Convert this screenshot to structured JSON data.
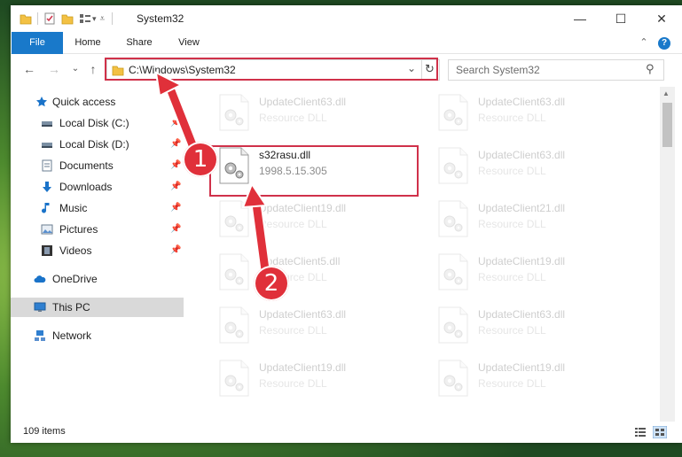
{
  "window": {
    "title": "System32",
    "minimize_glyph": "—",
    "maximize_glyph": "☐",
    "close_glyph": "✕",
    "help_glyph": "?",
    "collapse_glyph": "⌃"
  },
  "ribbon": {
    "tabs": [
      {
        "label": "File"
      },
      {
        "label": "Home"
      },
      {
        "label": "Share"
      },
      {
        "label": "View"
      }
    ]
  },
  "nav": {
    "back_glyph": "←",
    "forward_glyph": "→",
    "recent_glyph": "⌄",
    "up_glyph": "↑",
    "address": "C:\\Windows\\System32",
    "dropdown_glyph": "⌄",
    "refresh_glyph": "↻",
    "search_placeholder": "Search System32",
    "search_glyph": "⚲"
  },
  "sidebar": {
    "items": [
      {
        "label": "Quick access",
        "icon": "star-icon"
      },
      {
        "label": "Local Disk (C:)",
        "icon": "drive-icon"
      },
      {
        "label": "Local Disk (D:)",
        "icon": "drive-icon"
      },
      {
        "label": "Documents",
        "icon": "documents-icon"
      },
      {
        "label": "Downloads",
        "icon": "download-icon"
      },
      {
        "label": "Music",
        "icon": "music-icon"
      },
      {
        "label": "Pictures",
        "icon": "pictures-icon"
      },
      {
        "label": "Videos",
        "icon": "videos-icon"
      },
      {
        "label": "OneDrive",
        "icon": "cloud-icon"
      },
      {
        "label": "This PC",
        "icon": "pc-icon"
      },
      {
        "label": "Network",
        "icon": "network-icon"
      }
    ],
    "pin_glyph": "📌"
  },
  "files": {
    "left": [
      {
        "name": "UpdateClient63.dll",
        "desc": "Resource DLL"
      },
      {
        "name": "s32rasu.dll",
        "desc": "1998.5.15.305"
      },
      {
        "name": "UpdateClient19.dll",
        "desc": "Resource DLL"
      },
      {
        "name": "UpdateClient5.dll",
        "desc": "Resource DLL"
      },
      {
        "name": "UpdateClient63.dll",
        "desc": "Resource DLL"
      },
      {
        "name": "UpdateClient19.dll",
        "desc": "Resource DLL"
      }
    ],
    "right": [
      {
        "name": "UpdateClient63.dll",
        "desc": "Resource DLL"
      },
      {
        "name": "UpdateClient63.dll",
        "desc": "Resource DLL"
      },
      {
        "name": "UpdateClient21.dll",
        "desc": "Resource DLL"
      },
      {
        "name": "UpdateClient19.dll",
        "desc": "Resource DLL"
      },
      {
        "name": "UpdateClient63.dll",
        "desc": "Resource DLL"
      },
      {
        "name": "UpdateClient19.dll",
        "desc": "Resource DLL"
      }
    ]
  },
  "status": {
    "count": "109 items"
  },
  "annotations": {
    "badge1": "1",
    "badge2": "2",
    "highlight_color": "#d0314a",
    "badge_color": "#e0303a"
  },
  "colors": {
    "file_tab": "#1979ca",
    "selected_item": "#d9d9d9"
  }
}
